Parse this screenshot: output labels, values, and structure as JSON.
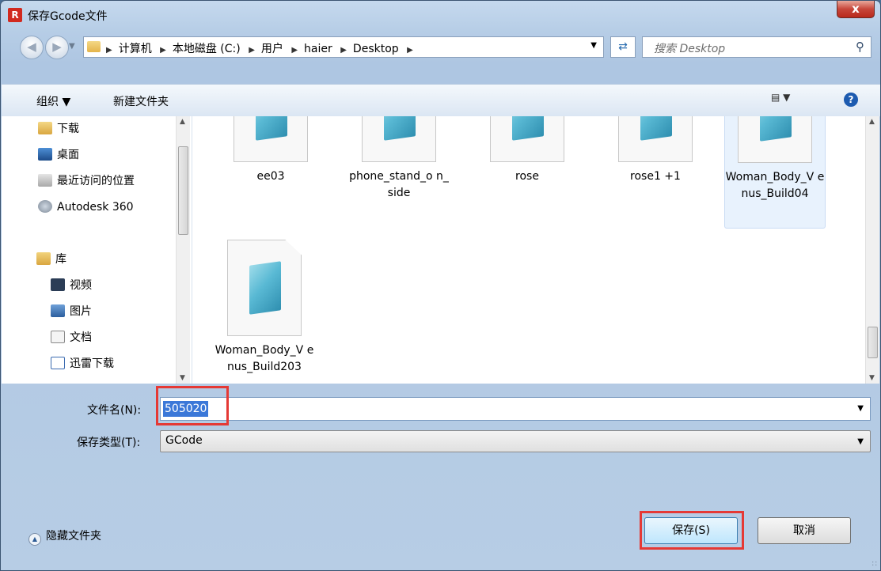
{
  "window": {
    "title": "保存Gcode文件",
    "app_icon": "R",
    "close_label": "x"
  },
  "nav": {
    "back_icon": "arrow-left-icon",
    "forward_icon": "arrow-right-icon",
    "breadcrumbs": [
      "计算机",
      "本地磁盘 (C:)",
      "用户",
      "haier",
      "Desktop"
    ],
    "search_placeholder": "搜索 Desktop"
  },
  "toolbar": {
    "organize": "组织 ▼",
    "new_folder": "新建文件夹"
  },
  "sidebar": {
    "favorites": [
      {
        "label": "下载",
        "icon": "download-folder-icon"
      },
      {
        "label": "桌面",
        "icon": "desktop-icon"
      },
      {
        "label": "最近访问的位置",
        "icon": "recent-places-icon"
      },
      {
        "label": "Autodesk 360",
        "icon": "cloud-icon"
      }
    ],
    "library_header": "库",
    "libraries": [
      {
        "label": "视频",
        "icon": "video-icon"
      },
      {
        "label": "图片",
        "icon": "picture-icon"
      },
      {
        "label": "文档",
        "icon": "document-icon"
      },
      {
        "label": "迅雷下载",
        "icon": "download-icon"
      }
    ]
  },
  "files": [
    {
      "name": "ee03"
    },
    {
      "name": "phone_stand_o n_side"
    },
    {
      "name": "rose"
    },
    {
      "name": "rose1 +1"
    },
    {
      "name": "Woman_Body_V enus_Build04",
      "selected": true
    },
    {
      "name": "Woman_Body_V enus_Build203"
    }
  ],
  "form": {
    "filename_label": "文件名(N):",
    "filename_value": "505020",
    "filetype_label": "保存类型(T):",
    "filetype_value": "GCode",
    "hide_folders": "隐藏文件夹",
    "save_button": "保存(S)",
    "cancel_button": "取消"
  },
  "colors": {
    "highlight": "#e53935",
    "selection": "#3b78d8"
  }
}
